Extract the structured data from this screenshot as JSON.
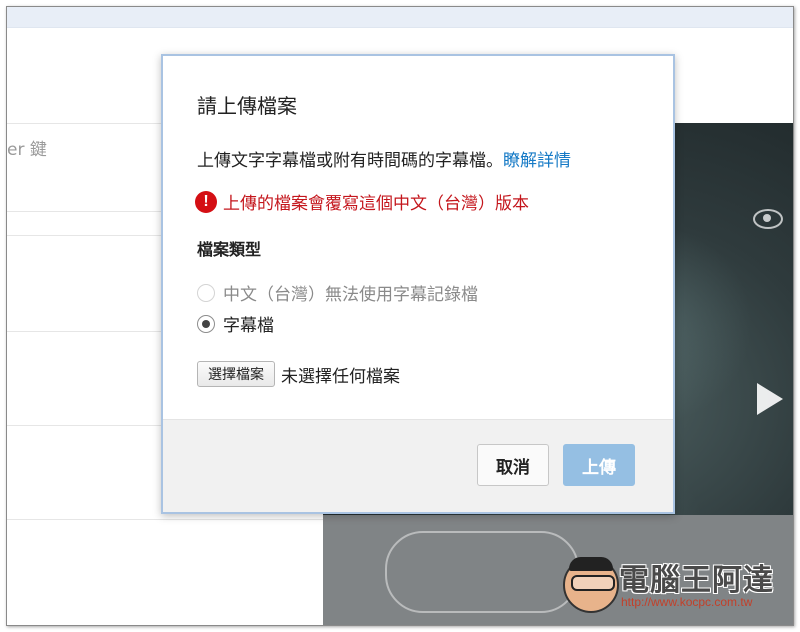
{
  "background": {
    "hint_text": "er 鍵"
  },
  "dialog": {
    "title": "請上傳檔案",
    "description": "上傳文字字幕檔或附有時間碼的字幕檔。",
    "learn_more_link": "瞭解詳情",
    "warning": "上傳的檔案會覆寫這個中文（台灣）版本",
    "warning_icon_glyph": "!",
    "file_type_label": "檔案類型",
    "options": [
      {
        "label": "中文（台灣）無法使用字幕記錄檔",
        "state": "disabled"
      },
      {
        "label": "字幕檔",
        "state": "selected"
      }
    ],
    "choose_file_button": "選擇檔案",
    "file_status": "未選擇任何檔案",
    "cancel_button": "取消",
    "upload_button": "上傳"
  },
  "watermark": {
    "title": "電腦王阿達",
    "url": "http://www.kocpc.com.tw"
  },
  "colors": {
    "link": "#167ac6",
    "warning": "#c4161c",
    "upload_button_disabled": "#95bfe3",
    "dialog_border": "#a9c3e2"
  },
  "icons": [
    "alert-circle-icon",
    "eye-icon",
    "play-icon"
  ]
}
